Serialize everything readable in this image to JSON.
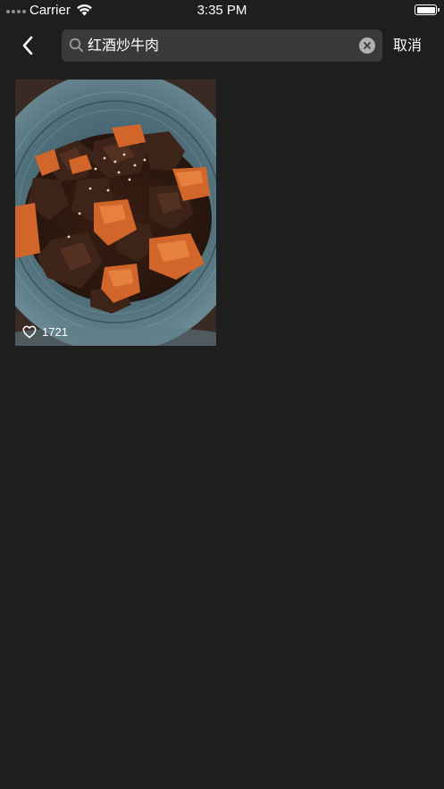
{
  "status_bar": {
    "carrier": "Carrier",
    "time": "3:35 PM",
    "wifi_icon": "wifi-icon",
    "battery_icon": "battery-icon"
  },
  "nav": {
    "back_icon": "chevron-left-icon",
    "search": {
      "value": "红酒炒牛肉",
      "search_icon": "search-icon",
      "clear_icon": "clear-icon"
    },
    "cancel_label": "取消"
  },
  "results": [
    {
      "image": "braised-beef-carrot-photo",
      "like_icon": "heart-icon",
      "likes": "1721"
    }
  ],
  "colors": {
    "background": "#1e1e1e",
    "search_field": "#3a3a3c",
    "text": "#ffffff"
  }
}
